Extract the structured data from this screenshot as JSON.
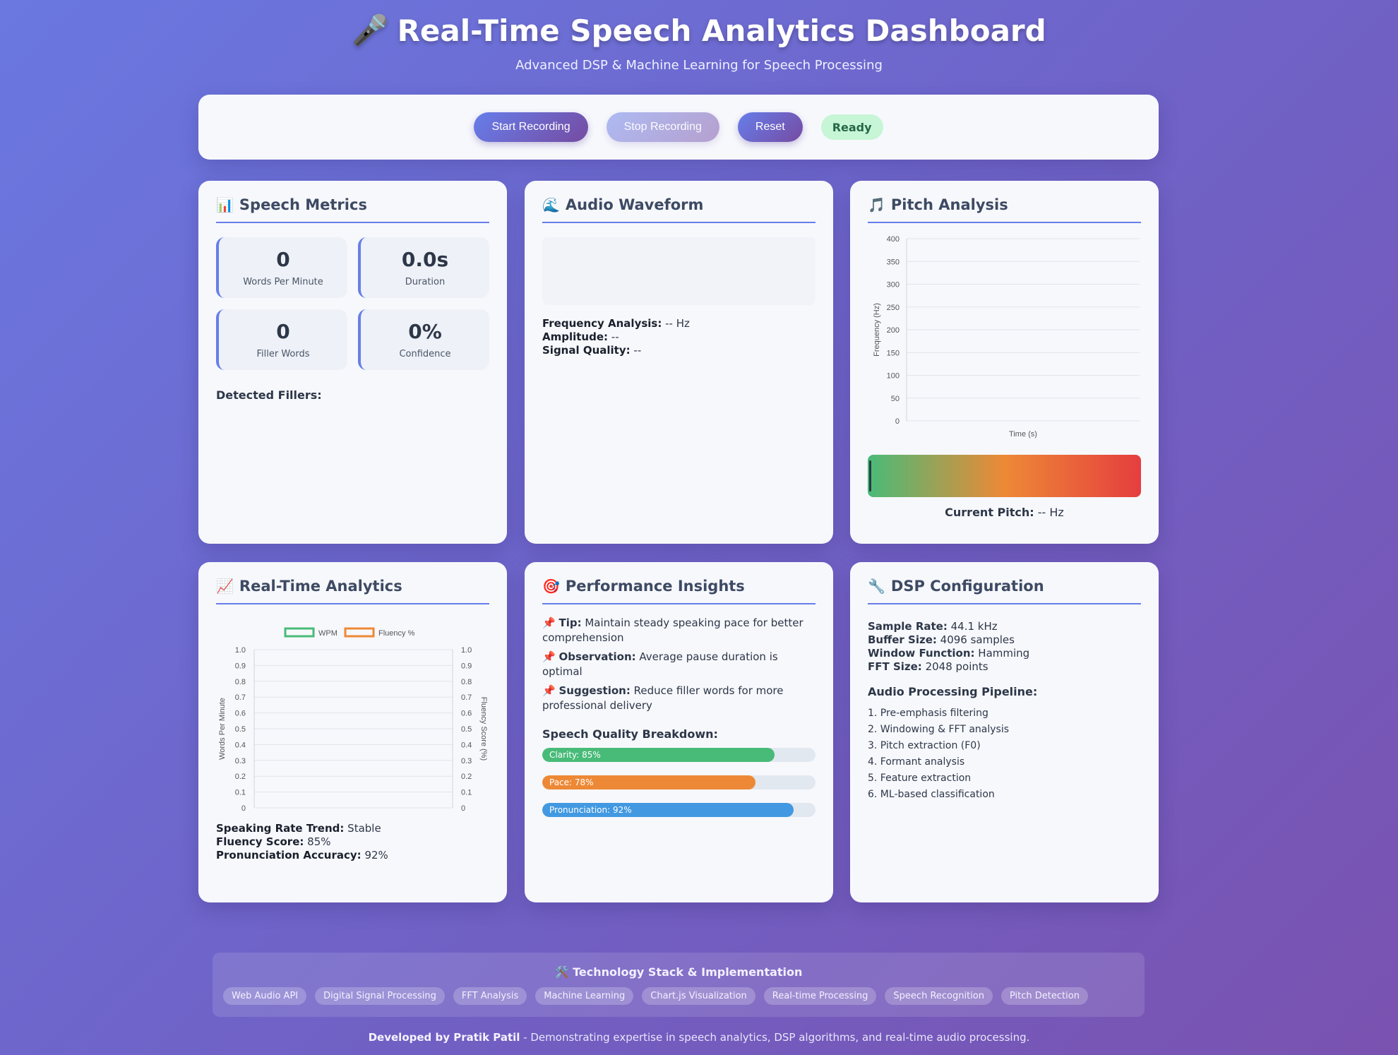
{
  "header": {
    "icon": "microphone-icon",
    "icon_glyph": "🎤",
    "title": "Real-Time Speech Analytics Dashboard",
    "subtitle": "Advanced DSP & Machine Learning for Speech Processing"
  },
  "controls": {
    "start_label": "Start Recording",
    "stop_label": "Stop Recording",
    "reset_label": "Reset",
    "status": "Ready"
  },
  "speech_metrics": {
    "icon_glyph": "📊",
    "title": "Speech Metrics",
    "wpm_value": "0",
    "wpm_label": "Words Per Minute",
    "duration_value": "0.0s",
    "duration_label": "Duration",
    "fillers_value": "0",
    "fillers_label": "Filler Words",
    "confidence_value": "0%",
    "confidence_label": "Confidence",
    "detected_fillers_label": "Detected Fillers:"
  },
  "waveform": {
    "icon_glyph": "🌊",
    "title": "Audio Waveform",
    "freq_label": "Frequency Analysis:",
    "freq_value": " -- Hz",
    "amp_label": "Amplitude:",
    "amp_value": " --",
    "quality_label": "Signal Quality:",
    "quality_value": " --"
  },
  "pitch": {
    "icon_glyph": "🎵",
    "title": "Pitch Analysis",
    "current_label": "Current Pitch:",
    "current_value": " -- Hz",
    "marker_fraction": 0
  },
  "analytics": {
    "icon_glyph": "📈",
    "title": "Real-Time Analytics",
    "trend_label": "Speaking Rate Trend:",
    "trend_value": " Stable",
    "fluency_label": "Fluency Score:",
    "fluency_value": " 85%",
    "pron_label": "Pronunciation Accuracy:",
    "pron_value": " 92%"
  },
  "insights": {
    "icon_glyph": "🎯",
    "title": "Performance Insights",
    "pin_glyph": "📌",
    "items": [
      {
        "label": "Tip:",
        "text": " Maintain steady speaking pace for better comprehension"
      },
      {
        "label": "Observation:",
        "text": " Average pause duration is optimal"
      },
      {
        "label": "Suggestion:",
        "text": " Reduce filler words for more professional delivery"
      }
    ],
    "breakdown_label": "Speech Quality Breakdown:",
    "bars": [
      {
        "label": "Clarity: 85%",
        "value": 85,
        "color": "#48bb78"
      },
      {
        "label": "Pace: 78%",
        "value": 78,
        "color": "#ed8936"
      },
      {
        "label": "Pronunciation: 92%",
        "value": 92,
        "color": "#4299e1"
      }
    ]
  },
  "dsp": {
    "icon_glyph": "🔧",
    "title": "DSP Configuration",
    "config": [
      {
        "label": "Sample Rate:",
        "value": " 44.1 kHz"
      },
      {
        "label": "Buffer Size:",
        "value": " 4096 samples"
      },
      {
        "label": "Window Function:",
        "value": " Hamming"
      },
      {
        "label": "FFT Size:",
        "value": " 2048 points"
      }
    ],
    "pipeline_label": "Audio Processing Pipeline:",
    "pipeline": [
      "1. Pre-emphasis filtering",
      "2. Windowing & FFT analysis",
      "3. Pitch extraction (F0)",
      "4. Formant analysis",
      "5. Feature extraction",
      "6. ML-based classification"
    ]
  },
  "footer": {
    "icon_glyph": "🛠️",
    "title": "Technology Stack & Implementation",
    "tags": [
      "Web Audio API",
      "Digital Signal Processing",
      "FFT Analysis",
      "Machine Learning",
      "Chart.js Visualization",
      "Real-time Processing",
      "Speech Recognition",
      "Pitch Detection"
    ],
    "credit_name": "Developed by Pratik Patil",
    "credit_text": " - Demonstrating expertise in speech analytics, DSP algorithms, and real-time audio processing."
  },
  "chart_data": [
    {
      "type": "line",
      "name": "pitch-chart",
      "series": [],
      "xlabel": "Time (s)",
      "ylabel": "Frequency (Hz)",
      "ylim": [
        0,
        400
      ],
      "yticks": [
        "400",
        "350",
        "300",
        "250",
        "200",
        "150",
        "100",
        "50",
        "0"
      ],
      "grid": true
    },
    {
      "type": "line",
      "name": "analytics-chart",
      "series": [
        {
          "name": "WPM",
          "color": "#48bb78",
          "values": []
        },
        {
          "name": "Fluency %",
          "color": "#ed8936",
          "values": []
        }
      ],
      "ylabel": "Words Per Minute",
      "y2label": "Fluency Score (%)",
      "ylim": [
        0,
        1
      ],
      "yticks": [
        "1.0",
        "0.9",
        "0.8",
        "0.7",
        "0.6",
        "0.5",
        "0.4",
        "0.3",
        "0.2",
        "0.1",
        "0"
      ],
      "grid": true,
      "legend": "top"
    }
  ]
}
